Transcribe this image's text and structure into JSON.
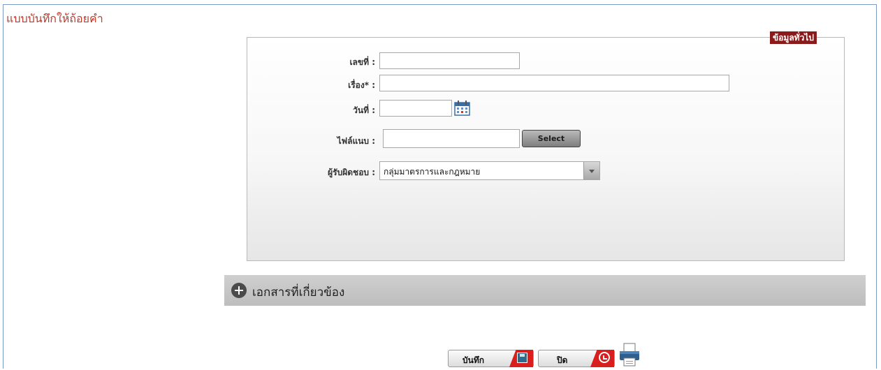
{
  "page": {
    "title": "แบบบันทึกให้ถ้อยคำ"
  },
  "general_info": {
    "section_label": "ข้อมูลทั่วไป",
    "number_label": "เลขที่ :",
    "number_value": "",
    "subject_label": "เรื่อง* :",
    "subject_value": "",
    "date_label": "วันที่ :",
    "date_value": "",
    "attachment_label": "ไฟล์แนบ :",
    "attachment_value": "",
    "select_button": "Select",
    "responsible_label": "ผู้รับผิดชอบ :",
    "responsible_value": "กลุ่มมาตรการและกฎหมาย"
  },
  "related_docs": {
    "label": "เอกสารที่เกี่ยวข้อง"
  },
  "actions": {
    "save_label": "บันทึก",
    "close_label": "ปิด"
  },
  "icons": {
    "calendar": "calendar-icon",
    "expand": "plus-circle-icon",
    "save": "save-icon",
    "close": "undo-icon",
    "print": "printer-icon"
  },
  "colors": {
    "title": "#c0392b",
    "section_label_bg": "#8b1a1a",
    "action_tab": "#d91e1e",
    "frame_border": "#7a9cc6"
  }
}
